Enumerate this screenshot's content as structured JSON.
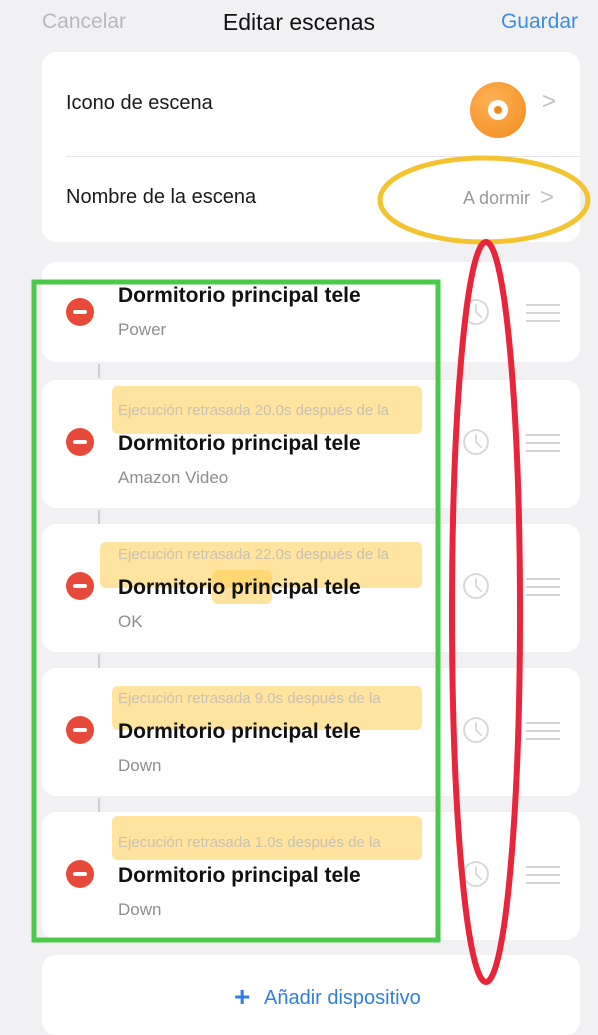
{
  "header": {
    "cancel_label": "Cancelar",
    "title": "Editar escenas",
    "save_label": "Guardar"
  },
  "settings": {
    "icon_row_label": "Icono de escena",
    "name_row_label": "Nombre de la escena",
    "name_value": "A dormir",
    "chevron": ">"
  },
  "actions": [
    {
      "delay": "",
      "device": "Dormitorio principal tele",
      "command": "Power"
    },
    {
      "delay": "Ejecución retrasada 20.0s después de la",
      "device": "Dormitorio principal tele",
      "command": "Amazon Video"
    },
    {
      "delay": "Ejecución retrasada 22.0s después de la",
      "device": "Dormitorio principal tele",
      "command": "OK"
    },
    {
      "delay": "Ejecución retrasada 9.0s después de la",
      "device": "Dormitorio principal tele",
      "command": "Down"
    },
    {
      "delay": "Ejecución retrasada 1.0s después de la",
      "device": "Dormitorio principal tele",
      "command": "Down"
    }
  ],
  "add_device": {
    "plus": "+",
    "label": "Añadir dispositivo"
  },
  "colors": {
    "accent": "#3a8ee6",
    "delete": "#e84a3a",
    "scene_icon": "#f08a1c",
    "annotation_green": "#4cc94a",
    "annotation_red": "#e8253a",
    "annotation_yellow": "#f4c430"
  },
  "icons": [
    "minus-circle-icon",
    "clock-icon",
    "drag-handle-icon",
    "chevron-right-icon",
    "plus-icon"
  ]
}
